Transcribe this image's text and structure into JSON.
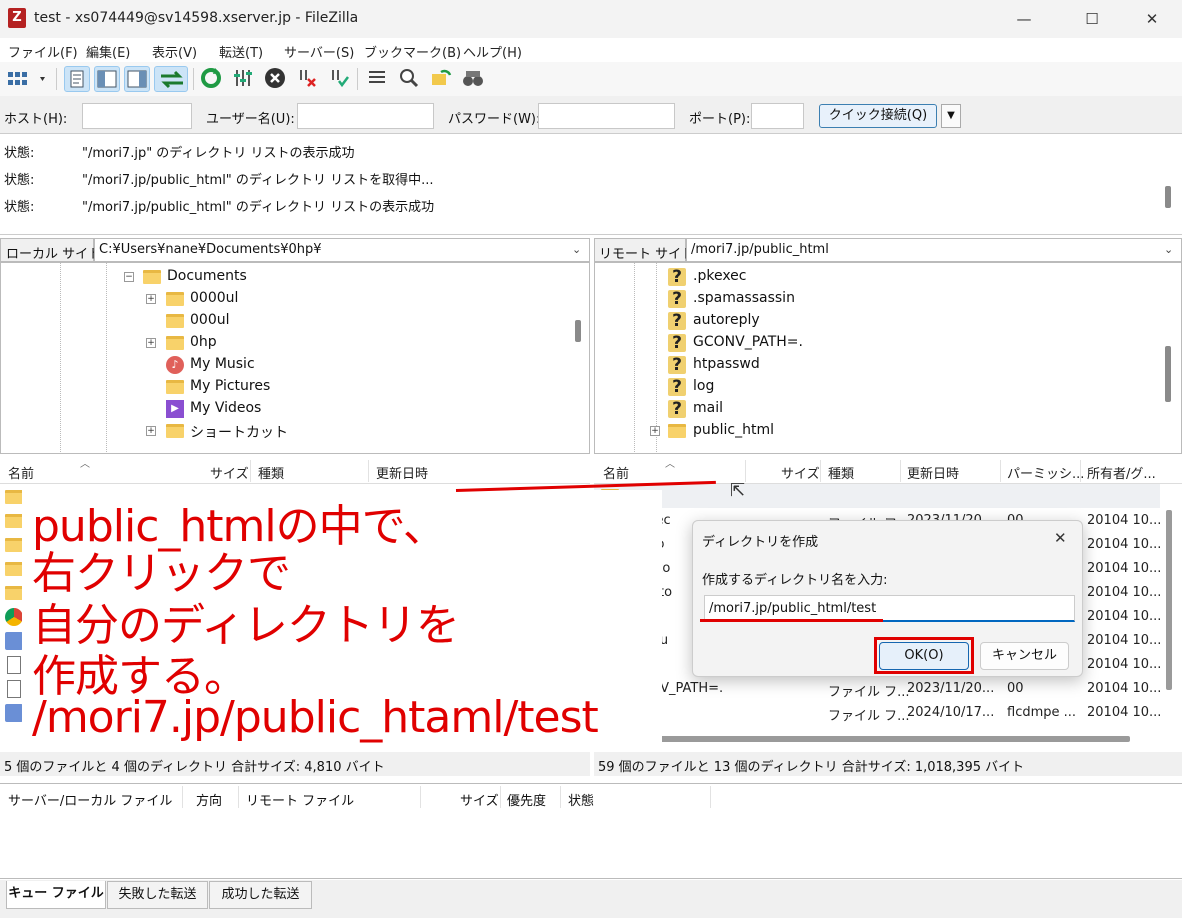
{
  "window": {
    "title": "test - xs074449@sv14598.xserver.jp - FileZilla",
    "app_icon": "Z",
    "minimize": "—",
    "maximize": "☐",
    "close": "✕"
  },
  "menu": [
    "ファイル(F)",
    "編集(E)",
    "表示(V)",
    "転送(T)",
    "サーバー(S)",
    "ブックマーク(B)",
    "ヘルプ(H)"
  ],
  "toolbar_icons": [
    "site-manager-icon",
    "toggle-log-icon",
    "toggle-local-tree-icon",
    "toggle-remote-tree-icon",
    "transfer-queue-icon",
    "refresh-icon",
    "process-queue-icon",
    "cancel-icon",
    "disconnect-icon",
    "reconnect-icon",
    "directory-listing-filter-icon",
    "compare-icon",
    "sync-browse-icon",
    "search-icon"
  ],
  "quickconnect": {
    "host_label": "ホスト(H):",
    "user_label": "ユーザー名(U):",
    "pass_label": "パスワード(W):",
    "port_label": "ポート(P):",
    "button": "クイック接続(Q)",
    "dropdown": "▼"
  },
  "log": [
    {
      "label": "状態:",
      "msg": "\"/mori7.jp\" のディレクトリ リストの表示成功"
    },
    {
      "label": "状態:",
      "msg": "\"/mori7.jp/public_html\" のディレクトリ リストを取得中..."
    },
    {
      "label": "状態:",
      "msg": "\"/mori7.jp/public_html\" のディレクトリ リストの表示成功"
    }
  ],
  "local": {
    "site_label": "ローカル サイト:",
    "path": "C:¥Users¥nane¥Documents¥0hp¥",
    "tree": [
      {
        "name": "Documents",
        "icon": "folder"
      },
      {
        "name": "0000ul",
        "icon": "folder"
      },
      {
        "name": "000ul",
        "icon": "folder"
      },
      {
        "name": "0hp",
        "icon": "folder"
      },
      {
        "name": "My Music",
        "icon": "music-folder"
      },
      {
        "name": "My Pictures",
        "icon": "folder"
      },
      {
        "name": "My Videos",
        "icon": "video-folder"
      },
      {
        "name": "ショートカット",
        "icon": "folder"
      }
    ],
    "headers": [
      "名前",
      "サイズ",
      "種類",
      "更新日時"
    ],
    "status": "5 個のファイルと 4 個のディレクトリ 合計サイズ: 4,810 バイト"
  },
  "remote": {
    "site_label": "リモート サイト:",
    "path": "/mori7.jp/public_html",
    "tree": [
      ".pkexec",
      ".spamassassin",
      "autoreply",
      "GCONV_PATH=.",
      "htpasswd",
      "log",
      "mail",
      "public_html"
    ],
    "headers": [
      "名前",
      "サイズ",
      "種類",
      "更新日時",
      "パーミッシ...",
      "所有者/グ..."
    ],
    "rows": [
      {
        "name": ".pkexec",
        "type": "ファイル フ...",
        "date": "2023/11/20...",
        "perm": "00",
        "owner": "20104 10..."
      },
      {
        "name": "aiyono",
        "type": "",
        "date": "",
        "perm": "",
        "owner": "20104 10..."
      },
      {
        "name": "akareto",
        "type": "",
        "date": "",
        "perm": "",
        "owner": "20104 10..."
      },
      {
        "name": "akasato",
        "type": "",
        "date": "",
        "perm": "",
        "owner": "20104 10..."
      },
      {
        "name": "akiiyu",
        "type": "",
        "date": "",
        "perm": "",
        "owner": "20104 10..."
      },
      {
        "name": "aosohu",
        "type": "",
        "date": "",
        "perm": "",
        "owner": "20104 10..."
      },
      {
        "name": "auoha",
        "type": "",
        "date": "",
        "perm": "",
        "owner": "20104 10..."
      },
      {
        "name": "GCONV_PATH=.",
        "type": "ファイル フ...",
        "date": "2023/11/20...",
        "perm": "00",
        "owner": "20104 10..."
      },
      {
        "name": "",
        "type": "ファイル フ...",
        "date": "2024/10/17...",
        "perm": "flcdmpe ...",
        "owner": "20104 10..."
      }
    ],
    "status": "59 個のファイルと 13 個のディレクトリ 合計サイズ: 1,018,395 バイト"
  },
  "queue": {
    "headers": [
      "サーバー/ローカル ファイル",
      "方向",
      "リモート ファイル",
      "サイズ",
      "優先度",
      "状態"
    ]
  },
  "tabs": [
    "キュー ファイル",
    "失敗した転送",
    "成功した転送"
  ],
  "dialog": {
    "title": "ディレクトリを作成",
    "prompt": "作成するディレクトリ名を入力:",
    "value": "/mori7.jp/public_html/test",
    "ok": "OK(O)",
    "cancel": "キャンセル",
    "close": "✕"
  },
  "annotation": [
    "public_htmlの中で、",
    "右クリックで",
    "自分のディレクトリを",
    "作成する。",
    "/mori7.jp/public_htaml/test"
  ],
  "colors": {
    "annotation": "#e00000",
    "accent": "#0067c0",
    "folder": "#f8d26a"
  }
}
